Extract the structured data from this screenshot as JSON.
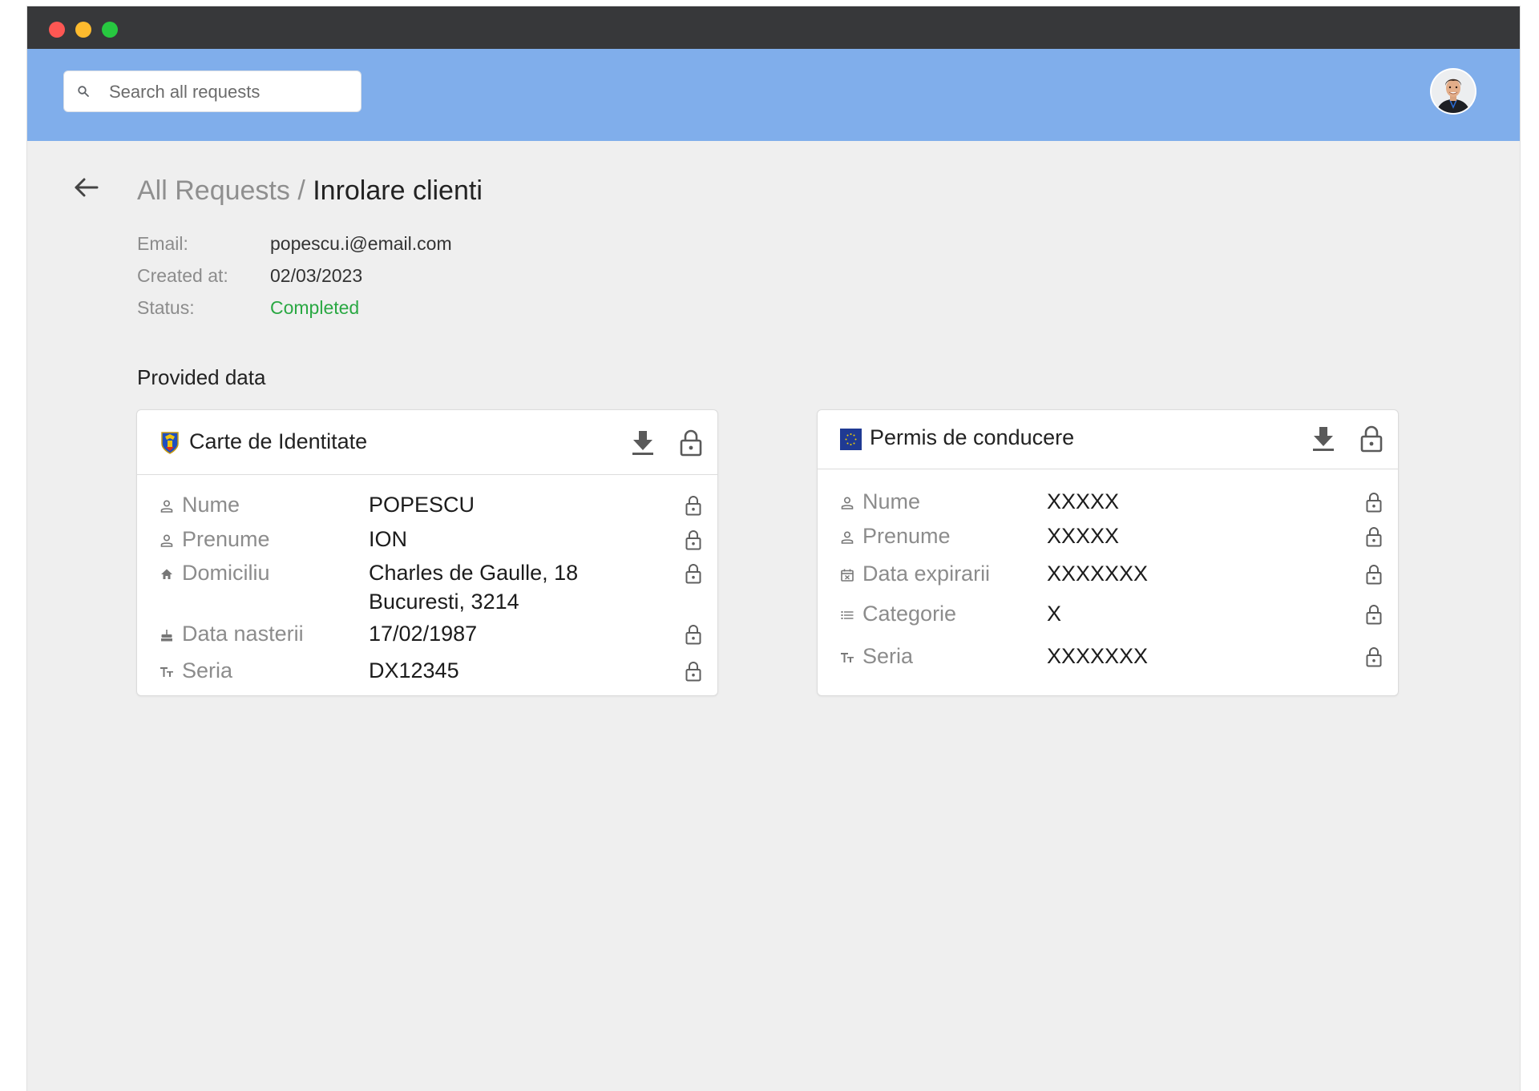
{
  "window": {
    "controls": [
      "close",
      "minimize",
      "maximize"
    ],
    "colors": {
      "close": "#fd5753",
      "minimize": "#febb2e",
      "maximize": "#27c840",
      "titlebar": "#37383a",
      "appbar": "#80aeeb",
      "status_completed": "#2aa843"
    }
  },
  "header": {
    "search": {
      "placeholder": "Search all requests",
      "value": "",
      "icon": "search-icon"
    },
    "avatar": {
      "icon": "user-avatar"
    }
  },
  "page": {
    "back_icon": "arrow-left-icon",
    "breadcrumb": {
      "root": "All Requests",
      "separator": " / ",
      "current": "Inrolare clienti"
    },
    "meta": [
      {
        "label": "Email:",
        "value": "popescu.i@email.com"
      },
      {
        "label": "Created at:",
        "value": "02/03/2023"
      },
      {
        "label": "Status:",
        "value": "Completed"
      }
    ],
    "section_title": "Provided data"
  },
  "cards": [
    {
      "title": "Carte de Identitate",
      "flag_icon": "romania-coat-of-arms-icon",
      "actions": [
        "download-icon",
        "lock-icon"
      ],
      "fields": [
        {
          "icon": "person-icon",
          "label": "Nume",
          "value": "POPESCU"
        },
        {
          "icon": "person-icon",
          "label": "Prenume",
          "value": "ION"
        },
        {
          "icon": "home-icon",
          "label": "Domiciliu",
          "value": "Charles de Gaulle, 18",
          "value2": "Bucuresti, 3214"
        },
        {
          "icon": "cake-icon",
          "label": "Data nasterii",
          "value": "17/02/1987"
        },
        {
          "icon": "text-format-icon",
          "label": "Seria",
          "value": "DX12345"
        }
      ]
    },
    {
      "title": "Permis de conducere",
      "flag_icon": "eu-flag-icon",
      "actions": [
        "download-icon",
        "lock-icon"
      ],
      "fields": [
        {
          "icon": "person-icon",
          "label": "Nume",
          "value": "XXXXX"
        },
        {
          "icon": "person-icon",
          "label": "Prenume",
          "value": "XXXXX"
        },
        {
          "icon": "calendar-x-icon",
          "label": "Data expirarii",
          "value": "XXXXXXX"
        },
        {
          "icon": "list-icon",
          "label": "Categorie",
          "value": "X"
        },
        {
          "icon": "text-format-icon",
          "label": "Seria",
          "value": "XXXXXXX"
        }
      ]
    }
  ]
}
